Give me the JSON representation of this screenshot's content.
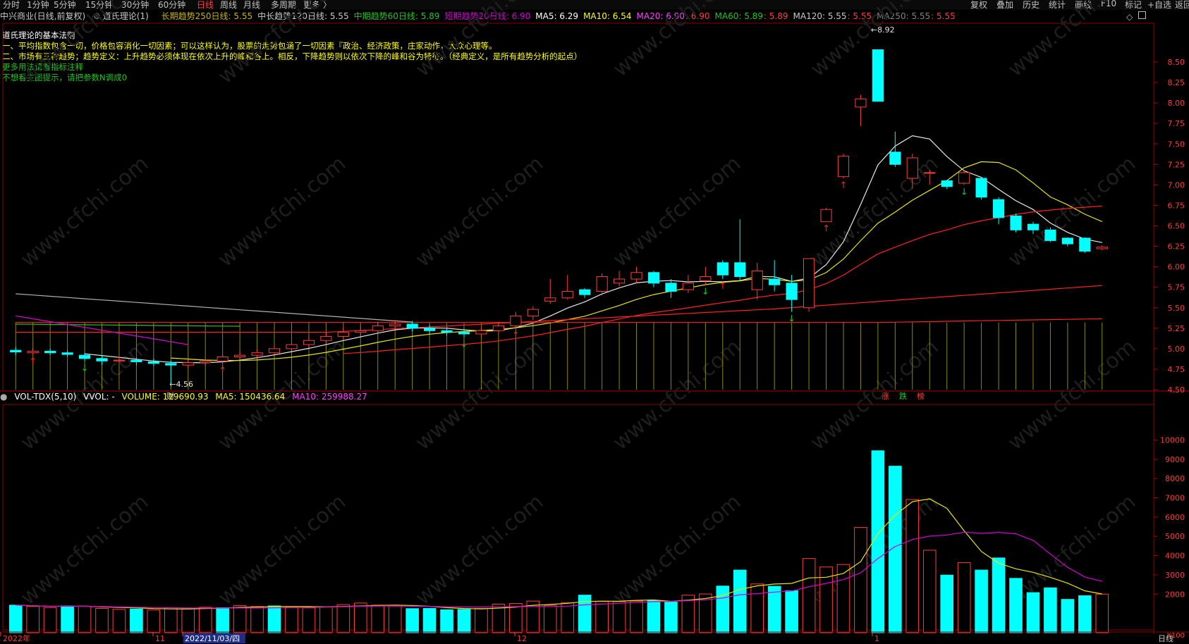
{
  "toolbar": {
    "periods": [
      "分时",
      "1分钟",
      "5分钟",
      "15分钟",
      "30分钟",
      "60分钟",
      "日线",
      "周线",
      "月线",
      "多周期",
      "更多 〉"
    ],
    "active": "日线",
    "right_buttons": [
      "复权",
      "叠加",
      "历史",
      "统计",
      "画线",
      "F10",
      "标记",
      "+自选",
      "返回"
    ]
  },
  "infobar": {
    "stock": "中兴商业(日线,前复权)",
    "indicator": "道氏理论(1)",
    "items": [
      {
        "text": "长期趋势250日线: 5.55",
        "color": "#c8b400"
      },
      {
        "text": "中长趋势120日线: 5.55",
        "color": "#c8c8c8"
      },
      {
        "text": "中期趋势60日线: 5.89",
        "color": "#21c321"
      },
      {
        "text": "短期趋势20日线: 6.90",
        "color": "#d600d6"
      },
      {
        "text": "MA5: 6.29",
        "color": "#ffffff"
      },
      {
        "text": "MA10: 6.54",
        "color": "#ffff00"
      },
      {
        "text": "MA20: 6.90",
        "color": "#ff40ff"
      },
      {
        "text": "MA60: 5.89",
        "color": "#21c321"
      },
      {
        "text": "MA120: 5.55",
        "color": "#c8c8c8"
      },
      {
        "text": "MA250: 5.55",
        "color": "#808080"
      }
    ],
    "red_values": [
      ": 6.90",
      ": 5.89",
      ": 5.55",
      ": 5.55"
    ]
  },
  "notes": [
    {
      "text": "道氏理论的基本法则",
      "color": "#ffffff"
    },
    {
      "text": "一、平均指数包含一切，价格包容消化一切因素；可以这样认为，股票的走势包涵了一切因素『政治、经济政策，庄家动作，大众心理等。",
      "color": "#ffff00"
    },
    {
      "text": "二、市场有三种趋势；趋势定义：上升趋势必须体现在依次上升的峰和谷上。相反，下降趋势则以依次下降的峰和谷为特征。（经典定义，是所有趋势分析的起点）",
      "color": "#ffff00"
    },
    {
      "text": "更多用法请看指标注释",
      "color": "#21c321"
    },
    {
      "text": "不想看主图提示，请把参数N调成0",
      "color": "#21c321"
    }
  ],
  "price_axis": [
    "8.50",
    "8.25",
    "8.00",
    "7.75",
    "7.50",
    "7.25",
    "7.00",
    "6.75",
    "6.50",
    "6.25",
    "6.00",
    "5.75",
    "5.50",
    "5.25",
    "5.00",
    "4.75",
    "4.50"
  ],
  "annotations": {
    "high": "8.92",
    "low": "4.56",
    "cai": "财",
    "badges": [
      "涨",
      "跌",
      "榜"
    ]
  },
  "vol_header": {
    "title": "VOL-TDX(5,10)",
    "vvol": "VVOL: -",
    "volume": "VOLUME: 119690.93",
    "ma5": "MA5: 150436.64",
    "ma10": "MA10: 259988.27"
  },
  "vol_axis": [
    "10000",
    "9000",
    "8000",
    "7000",
    "6000",
    "5000",
    "4000",
    "3000",
    "2000"
  ],
  "vol_unit": "X100",
  "date_axis": {
    "labels": [
      "2022年",
      "11",
      "2022/11/03/四",
      "12",
      "1"
    ],
    "right": "日线"
  },
  "watermark": "www.cfchi.com",
  "chart_data": {
    "type": "candlestick",
    "ylim": [
      4.45,
      9.0
    ],
    "candles": [
      [
        4.98,
        4.96,
        5.02,
        4.92
      ],
      [
        4.95,
        4.97,
        5.01,
        4.93
      ],
      [
        4.97,
        4.95,
        5.0,
        4.92
      ],
      [
        4.95,
        4.93,
        4.98,
        4.9
      ],
      [
        4.92,
        4.88,
        4.95,
        4.85
      ],
      [
        4.88,
        4.85,
        4.92,
        4.8
      ],
      [
        4.85,
        4.86,
        4.9,
        4.82
      ],
      [
        4.86,
        4.84,
        4.89,
        4.8
      ],
      [
        4.84,
        4.82,
        4.88,
        4.79
      ],
      [
        4.82,
        4.8,
        4.85,
        4.56
      ],
      [
        4.8,
        4.83,
        4.87,
        4.76
      ],
      [
        4.83,
        4.85,
        4.88,
        4.79
      ],
      [
        4.85,
        4.9,
        4.93,
        4.82
      ],
      [
        4.9,
        4.92,
        4.97,
        4.87
      ],
      [
        4.92,
        4.95,
        4.99,
        4.89
      ],
      [
        4.95,
        5.0,
        5.05,
        4.93
      ],
      [
        5.0,
        5.05,
        5.1,
        4.97
      ],
      [
        5.05,
        5.1,
        5.15,
        5.01
      ],
      [
        5.1,
        5.15,
        5.21,
        5.07
      ],
      [
        5.15,
        5.2,
        5.26,
        5.12
      ],
      [
        5.2,
        5.22,
        5.28,
        5.16
      ],
      [
        5.22,
        5.28,
        5.33,
        5.19
      ],
      [
        5.28,
        5.3,
        5.35,
        5.25
      ],
      [
        5.3,
        5.25,
        5.34,
        5.21
      ],
      [
        5.25,
        5.22,
        5.29,
        5.18
      ],
      [
        5.22,
        5.2,
        5.26,
        5.16
      ],
      [
        5.2,
        5.18,
        5.24,
        5.14
      ],
      [
        5.18,
        5.22,
        5.26,
        5.15
      ],
      [
        5.22,
        5.28,
        5.33,
        5.19
      ],
      [
        5.28,
        5.4,
        5.45,
        5.25
      ],
      [
        5.4,
        5.48,
        5.52,
        5.35
      ],
      [
        5.58,
        5.62,
        5.85,
        5.55
      ],
      [
        5.62,
        5.7,
        5.9,
        5.6
      ],
      [
        5.72,
        5.66,
        5.74,
        5.62
      ],
      [
        5.7,
        5.88,
        5.92,
        5.65
      ],
      [
        5.8,
        5.85,
        5.95,
        5.76
      ],
      [
        5.85,
        5.93,
        6.0,
        5.8
      ],
      [
        5.93,
        5.8,
        5.95,
        5.75
      ],
      [
        5.8,
        5.7,
        5.85,
        5.62
      ],
      [
        5.72,
        5.8,
        5.9,
        5.68
      ],
      [
        5.83,
        5.88,
        6.0,
        5.78
      ],
      [
        6.05,
        5.9,
        6.08,
        5.85
      ],
      [
        6.05,
        5.88,
        6.58,
        5.82
      ],
      [
        5.72,
        5.95,
        6.05,
        5.6
      ],
      [
        5.85,
        5.78,
        6.08,
        5.7
      ],
      [
        5.8,
        5.6,
        5.9,
        5.45
      ],
      [
        5.5,
        6.1,
        6.1,
        5.45
      ],
      [
        6.55,
        6.7,
        6.72,
        6.55
      ],
      [
        7.1,
        7.35,
        7.38,
        7.08
      ],
      [
        7.95,
        8.05,
        8.1,
        7.72
      ],
      [
        8.65,
        8.02,
        8.65,
        8.02
      ],
      [
        7.4,
        7.25,
        7.65,
        7.22
      ],
      [
        7.08,
        7.33,
        7.38,
        6.95
      ],
      [
        7.15,
        7.15,
        7.18,
        7.0
      ],
      [
        7.05,
        6.98,
        7.05,
        6.95
      ],
      [
        7.02,
        7.15,
        7.18,
        7.0
      ],
      [
        7.08,
        6.85,
        7.1,
        6.82
      ],
      [
        6.82,
        6.6,
        6.85,
        6.52
      ],
      [
        6.62,
        6.45,
        6.65,
        6.42
      ],
      [
        6.52,
        6.45,
        6.55,
        6.4
      ],
      [
        6.45,
        6.32,
        6.48,
        6.3
      ],
      [
        6.35,
        6.28,
        6.36,
        6.25
      ],
      [
        6.35,
        6.19,
        6.36,
        6.17
      ],
      [
        6.22,
        6.24,
        6.26,
        6.2
      ]
    ],
    "volume": [
      1430,
      1370,
      1310,
      1390,
      1380,
      1260,
      1210,
      1230,
      1180,
      1290,
      1250,
      1320,
      1300,
      1410,
      1360,
      1390,
      1330,
      1290,
      1330,
      1460,
      1540,
      1430,
      1380,
      1250,
      1260,
      1190,
      1210,
      1260,
      1480,
      1520,
      1640,
      1420,
      1560,
      1950,
      1620,
      1610,
      1640,
      1670,
      1590,
      1950,
      2010,
      2420,
      3250,
      2530,
      2410,
      2180,
      3850,
      3410,
      3540,
      5460,
      9440,
      8640,
      6910,
      4280,
      2990,
      3640,
      3250,
      3880,
      2820,
      2080,
      2330,
      1730,
      1920,
      2000
    ],
    "vol_down": [
      true,
      false,
      false,
      true,
      false,
      false,
      false,
      true,
      false,
      false,
      false,
      false,
      true,
      false,
      false,
      true,
      false,
      false,
      false,
      false,
      false,
      false,
      false,
      true,
      true,
      true,
      true,
      false,
      false,
      false,
      false,
      false,
      false,
      true,
      false,
      false,
      false,
      true,
      true,
      false,
      false,
      true,
      true,
      false,
      true,
      true,
      false,
      false,
      false,
      false,
      true,
      true,
      false,
      false,
      true,
      false,
      true,
      true,
      true,
      true,
      true,
      true,
      true,
      false
    ]
  }
}
